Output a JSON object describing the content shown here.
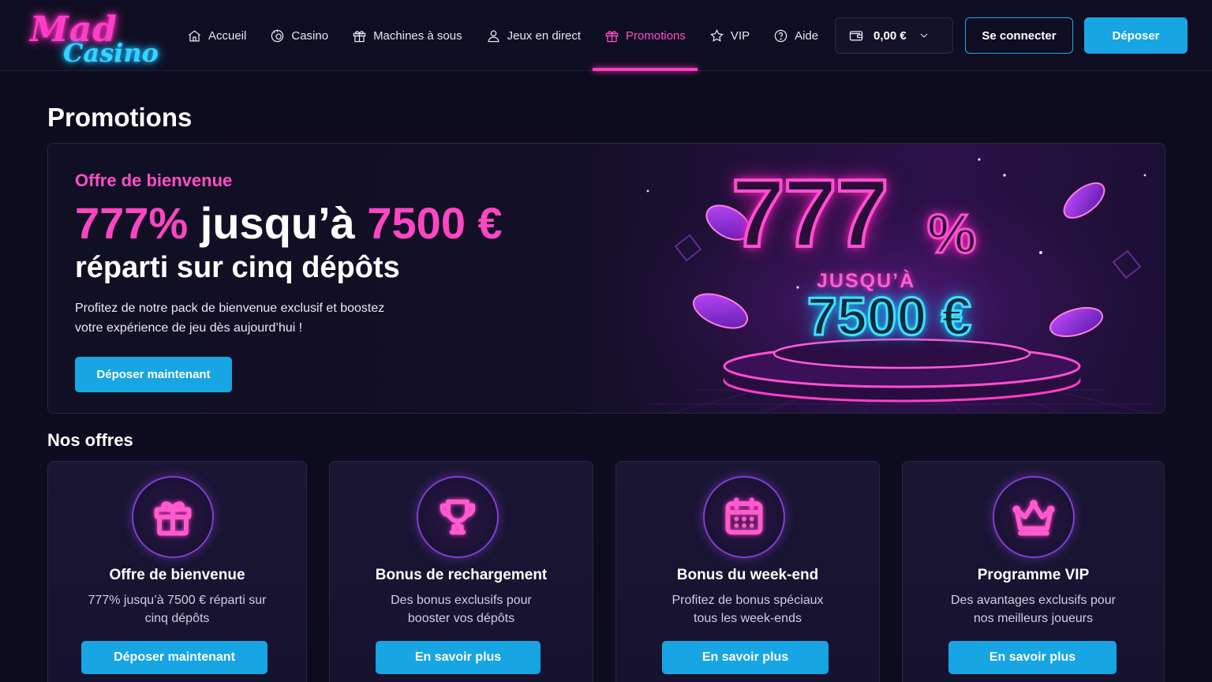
{
  "brand": {
    "logo_line1": "Mad",
    "logo_line2": "Casino"
  },
  "nav": {
    "items": [
      {
        "label": "Accueil",
        "icon": "home-icon"
      },
      {
        "label": "Casino",
        "icon": "casino-chip-icon"
      },
      {
        "label": "Machines à sous",
        "icon": "gift-icon"
      },
      {
        "label": "Jeux en direct",
        "icon": "user-icon"
      },
      {
        "label": "Promotions",
        "icon": "gift-icon",
        "active": true
      },
      {
        "label": "VIP",
        "icon": "star-icon"
      },
      {
        "label": "Aide",
        "icon": "help-icon"
      }
    ]
  },
  "header": {
    "balance": "0,00 €",
    "login_label": "Se connecter",
    "deposit_label": "Déposer"
  },
  "page": {
    "title": "Promotions"
  },
  "hero": {
    "eyebrow": "Offre de bienvenue",
    "headline_percent": "777%",
    "headline_mid": " jusqu’à ",
    "headline_amount": "7500 €",
    "subheadline": "réparti sur cinq dépôts",
    "description": "Profitez de notre pack de bienvenue exclusif et boostez votre expérience de jeu dès aujourd’hui !",
    "cta_label": "Déposer maintenant",
    "art": {
      "percent": "777",
      "percent_sign": "%",
      "up_to": "JUSQU’À",
      "amount": "7500 €"
    }
  },
  "offers": {
    "section_title": "Nos offres",
    "cards": [
      {
        "title": "Offre de bienvenue",
        "description": "777% jusqu’à 7500 € réparti sur cinq dépôts",
        "button": "Déposer maintenant",
        "icon": "gift-icon"
      },
      {
        "title": "Bonus de rechargement",
        "description": "Des bonus exclusifs pour booster vos dépôts",
        "button": "En savoir plus",
        "icon": "trophy-icon"
      },
      {
        "title": "Bonus du week-end",
        "description": "Profitez de bonus spéciaux tous les week-ends",
        "button": "En savoir plus",
        "icon": "calendar-icon"
      },
      {
        "title": "Programme VIP",
        "description": "Des avantages exclusifs pour nos meilleurs joueurs",
        "button": "En savoir plus",
        "icon": "crown-icon"
      }
    ]
  },
  "colors": {
    "background": "#0d0b1e",
    "accent_pink": "#ff46c2",
    "accent_blue": "#17a5e3",
    "neon_cyan": "#3fe0ff"
  }
}
